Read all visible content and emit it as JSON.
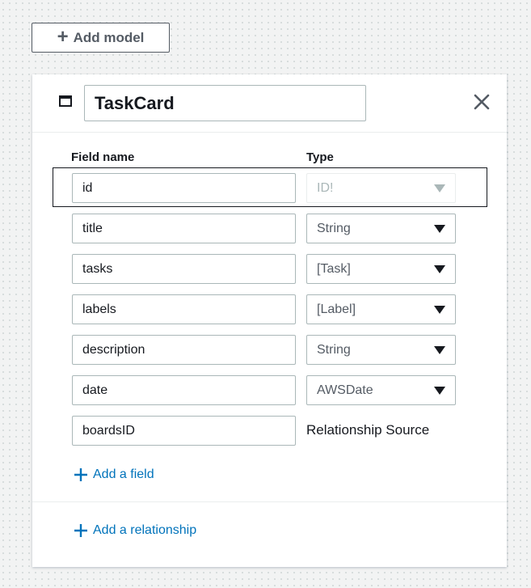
{
  "toolbar": {
    "add_model_label": "Add model",
    "add_model_icon": "plus-icon"
  },
  "model": {
    "icon": "table-icon",
    "name": "TaskCard",
    "close_icon": "close-icon",
    "columns": {
      "field_name": "Field name",
      "type": "Type"
    },
    "fields": [
      {
        "name": "id",
        "type": "ID!",
        "disabled": true
      },
      {
        "name": "title",
        "type": "String"
      },
      {
        "name": "tasks",
        "type": "[Task]"
      },
      {
        "name": "labels",
        "type": "[Label]"
      },
      {
        "name": "description",
        "type": "String"
      },
      {
        "name": "date",
        "type": "AWSDate"
      }
    ],
    "relationship_field": {
      "name": "boardsID",
      "label": "Relationship Source"
    },
    "add_field_label": "Add a field",
    "add_relationship_label": "Add a relationship"
  },
  "colors": {
    "link": "#0073bb",
    "border": "#aab7b8",
    "text": "#16191f",
    "background": "#f2f3f3"
  }
}
